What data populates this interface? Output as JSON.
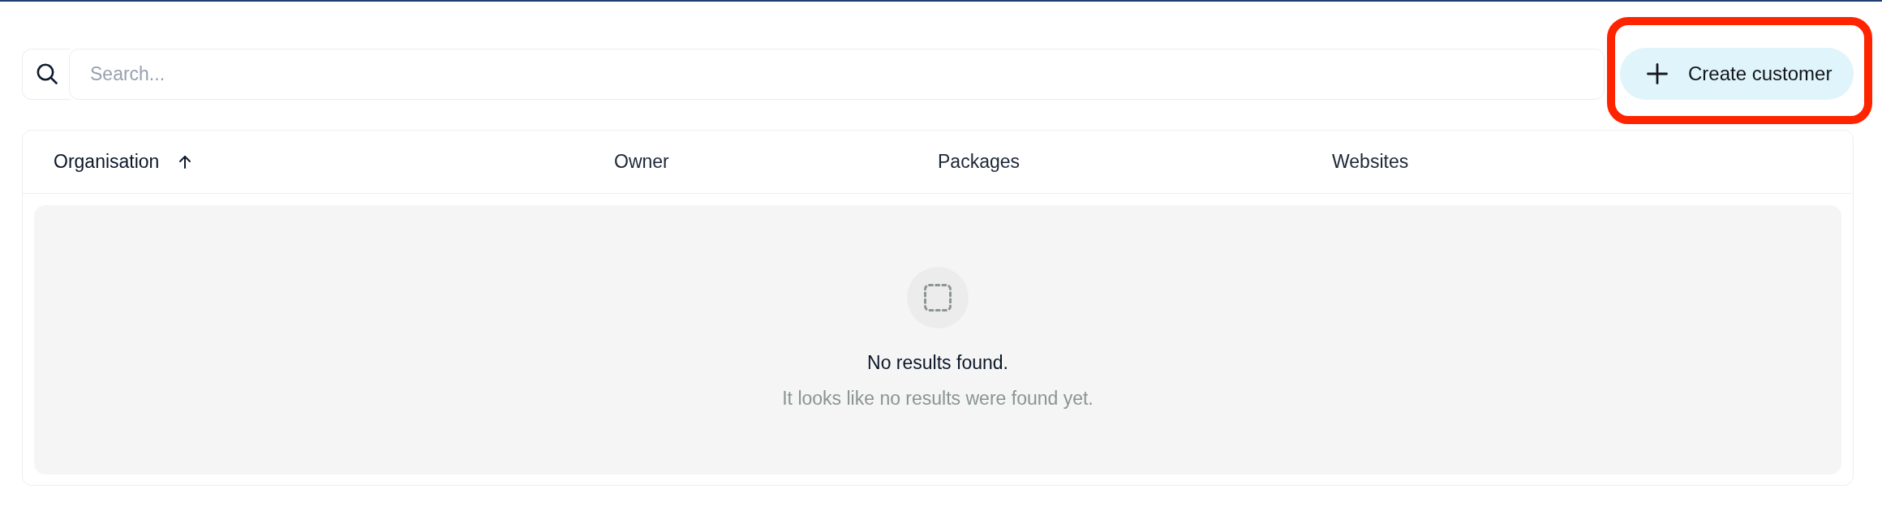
{
  "search": {
    "placeholder": "Search..."
  },
  "create_button": {
    "label": "Create customer",
    "highlighted": true
  },
  "table": {
    "columns": [
      {
        "label": "Organisation",
        "sorted": true
      },
      {
        "label": "Owner",
        "sorted": false
      },
      {
        "label": "Packages",
        "sorted": false
      },
      {
        "label": "Websites",
        "sorted": false
      }
    ]
  },
  "empty_state": {
    "title": "No results found.",
    "message": "It looks like no results were found yet."
  }
}
